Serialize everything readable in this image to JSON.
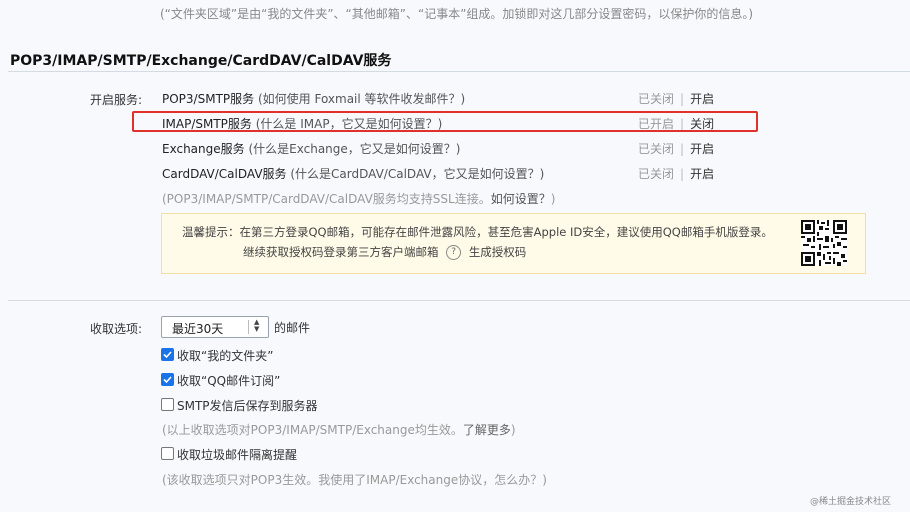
{
  "top_note": "(“文件夹区域”是由“我的文件夹”、“其他邮箱”、“记事本”组成。加锁即对这几部分设置密码，以保护你的信息。)",
  "section_title": "POP3/IMAP/SMTP/Exchange/CardDAV/CalDAV服务",
  "services": {
    "label": "开启服务:",
    "items": [
      {
        "name": "POP3/SMTP服务",
        "hint": "(如何使用 Foxmail 等软件收发邮件？)",
        "status": "已关闭",
        "action": "开启"
      },
      {
        "name": "IMAP/SMTP服务",
        "hint": "(什么是 IMAP，它又是如何设置？)",
        "status": "已开启",
        "action": "关闭"
      },
      {
        "name": "Exchange服务",
        "hint": "(什么是Exchange，它又是如何设置？)",
        "status": "已关闭",
        "action": "开启"
      },
      {
        "name": "CardDAV/CalDAV服务",
        "hint": "(什么是CardDAV/CalDAV，它又是如何设置？)",
        "status": "已关闭",
        "action": "开启"
      }
    ],
    "ssl_note_prefix": "(POP3/IMAP/SMTP/CardDAV/CalDAV服务均支持SSL连接。",
    "ssl_note_link": "如何设置？",
    "ssl_note_suffix": ")"
  },
  "warning": {
    "line1": "温馨提示：在第三方登录QQ邮箱，可能存在邮件泄露风险，甚至危害Apple ID安全，建议使用QQ邮箱手机版登录。",
    "line2_prefix": "继续获取授权码登录第三方客户端邮箱",
    "help_icon": "?",
    "line2_link": "生成授权码",
    "qr_icon": "qr-code-icon"
  },
  "fetch": {
    "label": "收取选项:",
    "select_value": "最近30天",
    "select_suffix": "的邮件",
    "options": [
      {
        "label": "收取“我的文件夹”",
        "checked": true
      },
      {
        "label": "收取“QQ邮件订阅”",
        "checked": true
      },
      {
        "label": "SMTP发信后保存到服务器",
        "checked": false
      }
    ],
    "note1_prefix": "(以上收取选项对POP3/IMAP/SMTP/Exchange均生效。",
    "note1_link": "了解更多",
    "note1_suffix": ")",
    "option_junk": {
      "label": "收取垃圾邮件隔离提醒",
      "checked": false
    },
    "note2": "(该收取选项只对POP3生效。我使用了IMAP/Exchange协议，怎么办？)"
  },
  "watermark": "@稀土掘金技术社区",
  "colors": {
    "accent": "#1a73e8",
    "highlight": "#e0312a",
    "warn_bg": "#fffbe8"
  }
}
